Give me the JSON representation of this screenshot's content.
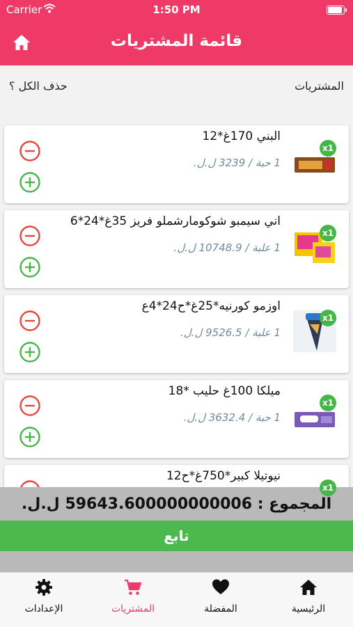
{
  "status": {
    "carrier": "Carrier",
    "time": "1:50 PM"
  },
  "navbar": {
    "title": "قائمة المشتريات",
    "home_icon": "home-icon"
  },
  "subheader": {
    "purchases_label": "المشتريات",
    "delete_all_label": "حذف الكل ؟"
  },
  "colors": {
    "accent": "#ef3a68",
    "green": "#4cb94e",
    "red": "#e6453b",
    "price": "#6f8b99"
  },
  "items": [
    {
      "name": "البني  170غ*12",
      "price": "1 حبة / 3239 ل.ل.",
      "qty": "x1"
    },
    {
      "name": "اني سيمبو شوكومارشملو فريز 35غ*24*6",
      "price": "1 علبة / 10748.9 ل.ل.",
      "qty": "x1"
    },
    {
      "name": "اوزمو كورنيه*25غ*ح24*4ع",
      "price": "1 علبة / 9526.5 ل.ل.",
      "qty": "x1"
    },
    {
      "name": "ميلكا 100غ حليب *18",
      "price": "1 حبة / 3632.4 ل.ل.",
      "qty": "x1"
    },
    {
      "name": "نيوتيلا كبير*750غ*ح12",
      "price": "",
      "qty": "x1"
    }
  ],
  "footer": {
    "total": "المجموع : 59643.600000000006 ل.ل.",
    "continue_label": "تابع"
  },
  "tabs": [
    {
      "label": "الإعدادات",
      "icon": "gear-icon"
    },
    {
      "label": "المشتريات",
      "icon": "cart-icon"
    },
    {
      "label": "المفضلة",
      "icon": "heart-icon"
    },
    {
      "label": "الرئيسية",
      "icon": "home-icon"
    }
  ]
}
